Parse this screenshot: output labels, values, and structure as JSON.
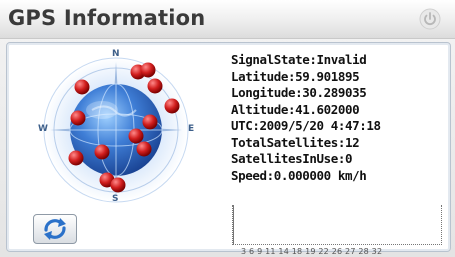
{
  "window": {
    "title": "GPS Information"
  },
  "info": {
    "signal_state": "SignalState:Invalid",
    "latitude": "Latitude:59.901895",
    "longitude": "Longitude:30.289035",
    "altitude": "Altitude:41.602000",
    "utc": "UTC:2009/5/20 4:47:18",
    "total_satellites": "TotalSatellites:12",
    "satellites_in_use": "SatellitesInUse:0",
    "speed": "Speed:0.000000 km/h"
  },
  "compass": {
    "n": "N",
    "e": "E",
    "s": "S",
    "w": "W"
  },
  "satellite_ids": "3 6 9 11 14 18 19 22 26 27 28 32",
  "icons": {
    "power": "power-icon",
    "refresh": "refresh-icon",
    "globe": "globe-icon"
  },
  "colors": {
    "satellite": "#d11e1e",
    "globe": "#2f67c6",
    "title_text": "#3a3a3a"
  }
}
